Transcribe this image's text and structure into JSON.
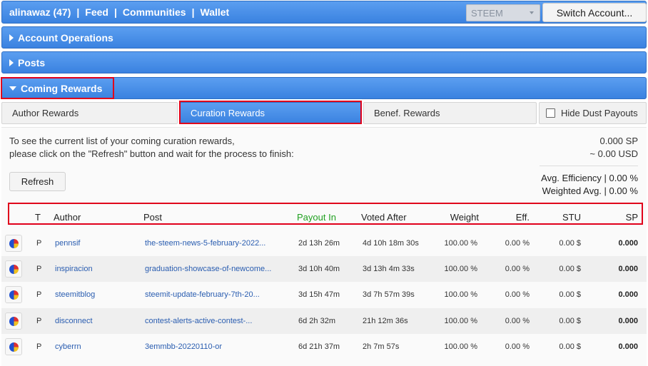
{
  "topbar": {
    "user": "alinawaz (47)",
    "sep": "|",
    "feed": "Feed",
    "communities": "Communities",
    "wallet": "Wallet",
    "chain": "STEEM",
    "switch_label": "Switch Account..."
  },
  "sections": {
    "account_ops": "Account Operations",
    "posts": "Posts",
    "coming_rewards": "Coming Rewards"
  },
  "tabs": {
    "author": "Author Rewards",
    "curation": "Curation Rewards",
    "benef": "Benef. Rewards",
    "hide_dust": "Hide Dust Payouts"
  },
  "info": {
    "line1": "To see the current list of your coming curation rewards,",
    "line2": "please click on the \"Refresh\" button and wait for the process to finish:",
    "total_sp": "0.000 SP",
    "total_usd": "~ 0.00 USD",
    "avg_eff": "Avg. Efficiency | 0.00 %",
    "weighted_avg": "Weighted Avg. | 0.00 %",
    "refresh": "Refresh"
  },
  "table": {
    "headers": {
      "t": "T",
      "author": "Author",
      "post": "Post",
      "payout": "Payout In",
      "voted": "Voted After",
      "weight": "Weight",
      "eff": "Eff.",
      "stu": "STU",
      "sp": "SP"
    },
    "rows": [
      {
        "t": "P",
        "author": "pennsif",
        "post": "the-steem-news-5-february-2022...",
        "payout": "2d 13h 26m",
        "voted": "4d 10h 18m 30s",
        "weight": "100.00 %",
        "eff": "0.00 %",
        "stu": "0.00 $",
        "sp": "0.000"
      },
      {
        "t": "P",
        "author": "inspiracion",
        "post": "graduation-showcase-of-newcome...",
        "payout": "3d 10h 40m",
        "voted": "3d 13h 4m 33s",
        "weight": "100.00 %",
        "eff": "0.00 %",
        "stu": "0.00 $",
        "sp": "0.000"
      },
      {
        "t": "P",
        "author": "steemitblog",
        "post": "steemit-update-february-7th-20...",
        "payout": "3d 15h 47m",
        "voted": "3d 7h 57m 39s",
        "weight": "100.00 %",
        "eff": "0.00 %",
        "stu": "0.00 $",
        "sp": "0.000"
      },
      {
        "t": "P",
        "author": "disconnect",
        "post": "contest-alerts-active-contest-...",
        "payout": "6d 2h 32m",
        "voted": "21h 12m 36s",
        "weight": "100.00 %",
        "eff": "0.00 %",
        "stu": "0.00 $",
        "sp": "0.000"
      },
      {
        "t": "P",
        "author": "cyberrn",
        "post": "3emmbb-20220110-or",
        "payout": "6d 21h 37m",
        "voted": "2h 7m 57s",
        "weight": "100.00 %",
        "eff": "0.00 %",
        "stu": "0.00 $",
        "sp": "0.000"
      }
    ]
  },
  "colors": {
    "bar_blue": "#3a82e0",
    "highlight_red": "#e0001b",
    "payout_green": "#20a020",
    "link_blue": "#2a5db0"
  }
}
